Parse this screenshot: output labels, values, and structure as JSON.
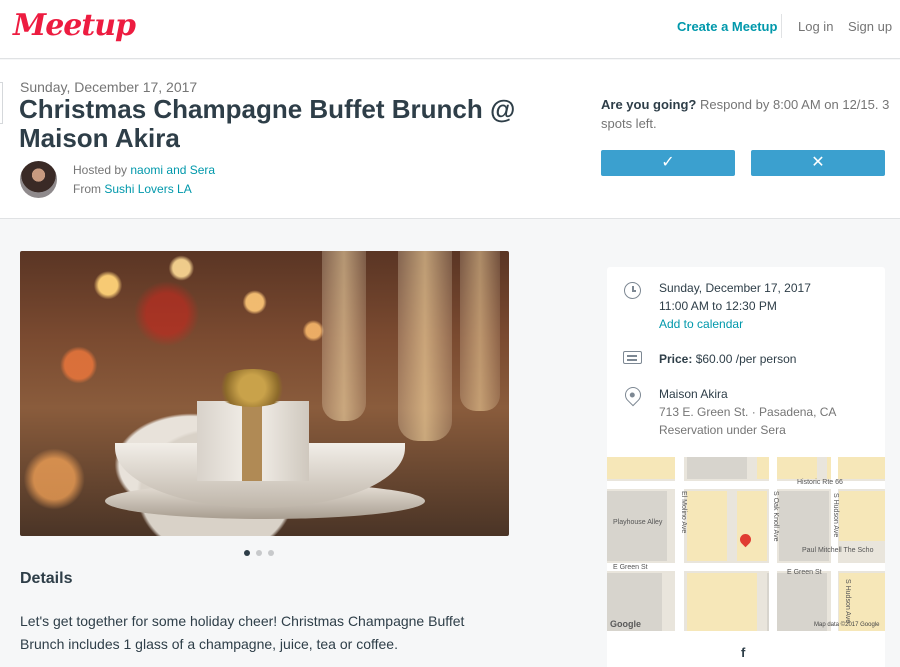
{
  "nav": {
    "logo": "Meetup",
    "create": "Create a Meetup",
    "login": "Log in",
    "signup": "Sign up"
  },
  "event": {
    "date": "Sunday, December 17, 2017",
    "title": "Christmas Champagne Buffet Brunch @ Maison Akira",
    "hosted_prefix": "Hosted by ",
    "hosts": "naomi and Sera",
    "from_prefix": "From ",
    "group": "Sushi Lovers LA"
  },
  "rsvp": {
    "question": "Are you going?",
    "respond": "Respond by 8:00 AM on 12/15.",
    "spots_num": "3",
    "spots_text": "spots left.",
    "yes_icon": "✓",
    "no_icon": "✕"
  },
  "photo_dots": {
    "count": 3,
    "active": 0
  },
  "details": {
    "heading": "Details",
    "text": "Let's get together for some holiday cheer! Christmas Champagne Buffet Brunch includes 1 glass of a champagne, juice, tea or coffee."
  },
  "card": {
    "date": "Sunday, December 17, 2017",
    "time": "11:00 AM to 12:30 PM",
    "add_calendar": "Add to calendar",
    "price_label": "Price:",
    "price_value": " $60.00 /per person",
    "venue": "Maison Akira",
    "address": "713 E. Green St. · Pasadena, CA",
    "note": "Reservation under Sera"
  },
  "map": {
    "labels": {
      "historic": "Historic Rte 66",
      "playhouse": "Playhouse Alley",
      "paul": "Paul Mitchell The Scho",
      "green1": "E Green St",
      "green2": "E Green St",
      "madison": "El Molino Ave",
      "oakknoll": "S Oak Knoll Ave",
      "hudson1": "S Hudson Ave",
      "hudson2": "S Hudson Ave"
    },
    "google": "Google",
    "credit": "Map data ©2017 Google"
  },
  "share": {
    "facebook": "f"
  }
}
